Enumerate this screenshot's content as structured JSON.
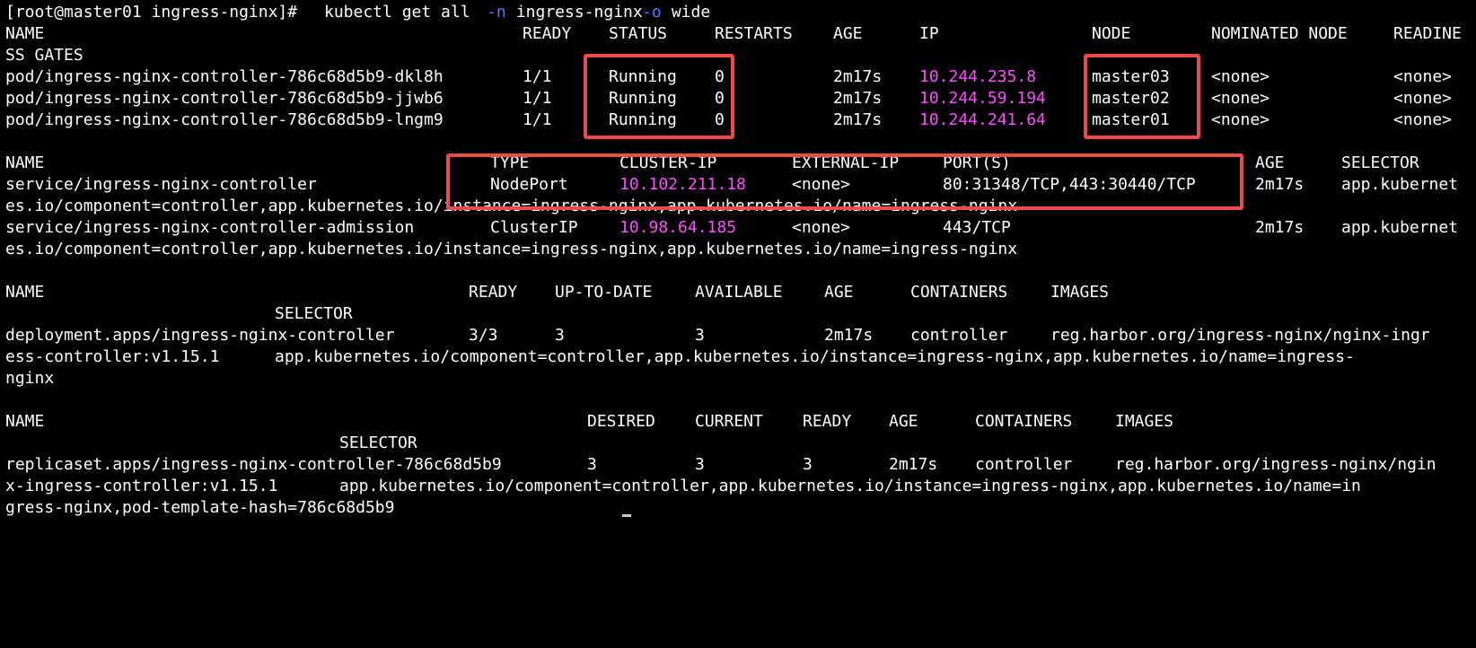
{
  "prompt": {
    "user_host": "[root@master01 ingress-nginx]# ",
    "cmd_a": "kubectl get all ",
    "flag_n": "-n",
    "cmd_b": " ingress-nginx ",
    "flag_o": "-o",
    "cmd_c": " wide"
  },
  "pods": {
    "headers": {
      "name": "NAME",
      "ready": "READY",
      "status": "STATUS",
      "restarts": "RESTARTS",
      "age": "AGE",
      "ip": "IP",
      "node": "NODE",
      "nominated": "NOMINATED NODE",
      "readiness": "READINE",
      "readiness_wrap": "SS GATES"
    },
    "rows": [
      {
        "name": "pod/ingress-nginx-controller-786c68d5b9-dkl8h",
        "ready": "1/1",
        "status": "Running",
        "restarts": "0",
        "age": "2m17s",
        "ip": "10.244.235.8",
        "node": "master03",
        "nominated": "<none>",
        "readiness": "<none>"
      },
      {
        "name": "pod/ingress-nginx-controller-786c68d5b9-jjwb6",
        "ready": "1/1",
        "status": "Running",
        "restarts": "0",
        "age": "2m17s",
        "ip": "10.244.59.194",
        "node": "master02",
        "nominated": "<none>",
        "readiness": "<none>"
      },
      {
        "name": "pod/ingress-nginx-controller-786c68d5b9-lngm9",
        "ready": "1/1",
        "status": "Running",
        "restarts": "0",
        "age": "2m17s",
        "ip": "10.244.241.64",
        "node": "master01",
        "nominated": "<none>",
        "readiness": "<none>"
      }
    ]
  },
  "services": {
    "headers": {
      "name": "NAME",
      "type": "TYPE",
      "cluster_ip": "CLUSTER-IP",
      "external_ip": "EXTERNAL-IP",
      "ports": "PORT(S)",
      "age": "AGE",
      "selector": "SELECTOR"
    },
    "rows": [
      {
        "name": "service/ingress-nginx-controller",
        "type": "NodePort",
        "cluster_ip": "10.102.211.18",
        "external_ip": "<none>",
        "ports": "80:31348/TCP,443:30440/TCP",
        "age": "2m17s",
        "selector": "app.kubernet",
        "selector_wrap": "es.io/component=controller,app.kubernetes.io/instance=ingress-nginx,app.kubernetes.io/name=ingress-nginx"
      },
      {
        "name": "service/ingress-nginx-controller-admission",
        "type": "ClusterIP",
        "cluster_ip": "10.98.64.185",
        "external_ip": "<none>",
        "ports": "443/TCP",
        "age": "2m17s",
        "selector": "app.kubernet",
        "selector_wrap": "es.io/component=controller,app.kubernetes.io/instance=ingress-nginx,app.kubernetes.io/name=ingress-nginx"
      }
    ]
  },
  "deployments": {
    "headers": {
      "name": "NAME",
      "ready": "READY",
      "up_to_date": "UP-TO-DATE",
      "available": "AVAILABLE",
      "age": "AGE",
      "containers": "CONTAINERS",
      "images": "IMAGES",
      "selector": "SELECTOR"
    },
    "row": {
      "name": "deployment.apps/ingress-nginx-controller",
      "ready": "3/3",
      "up_to_date": "3",
      "available": "3",
      "age": "2m17s",
      "containers": "controller",
      "images": "reg.harbor.org/ingress-nginx/nginx-ingr",
      "wrap1_a": "ess-controller:v1.15.1",
      "wrap1_b": "app.kubernetes.io/component=controller,app.kubernetes.io/instance=ingress-nginx,app.kubernetes.io/name=ingress-",
      "wrap2": "nginx"
    }
  },
  "replicasets": {
    "headers": {
      "name": "NAME",
      "desired": "DESIRED",
      "current": "CURRENT",
      "ready": "READY",
      "age": "AGE",
      "containers": "CONTAINERS",
      "images": "IMAGES",
      "selector": "SELECTOR"
    },
    "row": {
      "name": "replicaset.apps/ingress-nginx-controller-786c68d5b9",
      "desired": "3",
      "current": "3",
      "ready": "3",
      "age": "2m17s",
      "containers": "controller",
      "images": "reg.harbor.org/ingress-nginx/ngin",
      "wrap1_a": "x-ingress-controller:v1.15.1",
      "wrap1_b": "app.kubernetes.io/component=controller,app.kubernetes.io/instance=ingress-nginx,app.kubernetes.io/name=in",
      "wrap2": "gress-nginx,pod-template-hash=786c68d5b9"
    }
  },
  "colors": {
    "background": "#000000",
    "text": "#ffffff",
    "ip_magenta": "#ff4dff",
    "flag_blue": "#4a7cff",
    "annotation_red": "#ea4b4b"
  }
}
